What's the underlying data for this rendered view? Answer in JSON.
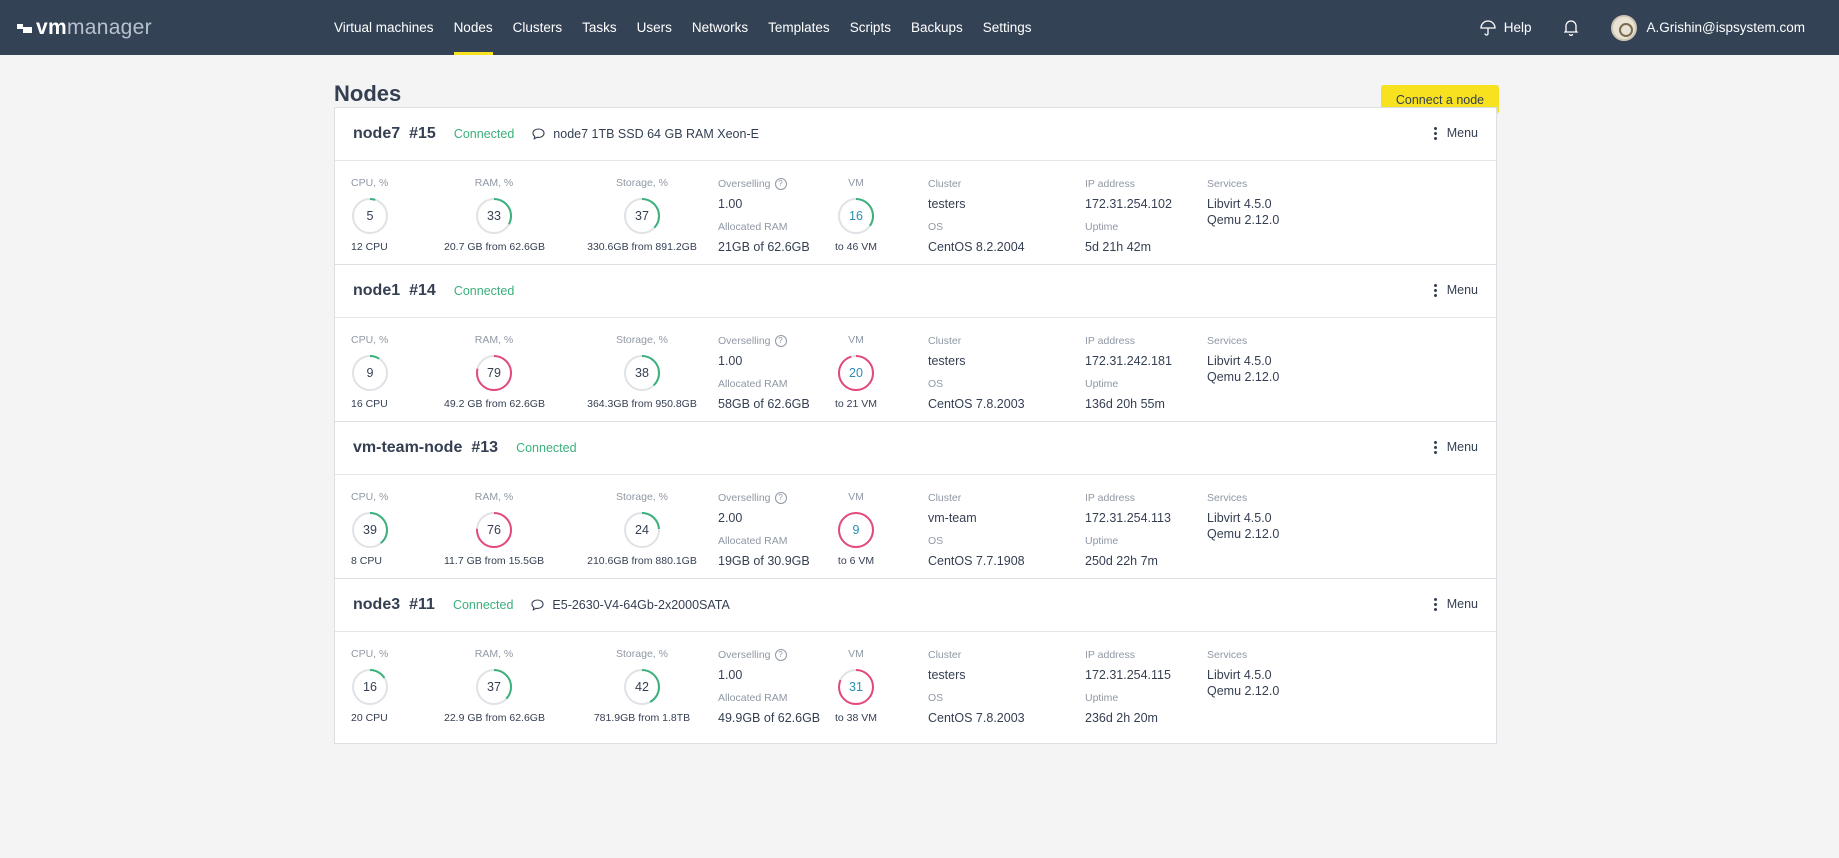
{
  "app": {
    "logo_vm": "vm",
    "logo_manager": "manager",
    "nav": [
      "Virtual machines",
      "Nodes",
      "Clusters",
      "Tasks",
      "Users",
      "Networks",
      "Templates",
      "Scripts",
      "Backups",
      "Settings"
    ],
    "active_nav": "Nodes",
    "help_label": "Help",
    "user_email": "A.Grishin@ispsystem.com"
  },
  "page": {
    "title": "Nodes",
    "connect_button": "Connect a node"
  },
  "labels": {
    "cpu": "CPU, %",
    "ram": "RAM, %",
    "storage": "Storage, %",
    "overselling": "Overselling",
    "allocated_ram": "Allocated RAM",
    "vm": "VM",
    "cluster": "Cluster",
    "os": "OS",
    "ip": "IP address",
    "uptime": "Uptime",
    "services": "Services",
    "menu": "Menu",
    "help_mark": "?"
  },
  "colors": {
    "ok": "#3bb07b",
    "warn": "#e34a7b",
    "accent": "#f8e21f"
  },
  "nodes": [
    {
      "name": "node7",
      "id": "#15",
      "status": "Connected",
      "comment": "node7 1TB SSD 64 GB RAM Xeon-E",
      "cpu": 5,
      "cpu_sub": "12 CPU",
      "ram": 33,
      "ram_sub": "20.7 GB from 62.6GB",
      "storage": 37,
      "storage_sub": "330.6GB from 891.2GB",
      "overselling": "1.00",
      "allocated_ram": "21GB of 62.6GB",
      "vm": 16,
      "vm_max": 46,
      "vm_sub": "to 46 VM",
      "cluster": "testers",
      "os": "CentOS 8.2.2004",
      "ip": "172.31.254.102",
      "uptime": "5d 21h 42m",
      "services": [
        "Libvirt 4.5.0",
        "Qemu 2.12.0"
      ]
    },
    {
      "name": "node1",
      "id": "#14",
      "status": "Connected",
      "comment": "",
      "cpu": 9,
      "cpu_sub": "16 CPU",
      "ram": 79,
      "ram_sub": "49.2 GB from 62.6GB",
      "storage": 38,
      "storage_sub": "364.3GB from 950.8GB",
      "overselling": "1.00",
      "allocated_ram": "58GB of 62.6GB",
      "vm": 20,
      "vm_max": 21,
      "vm_sub": "to 21 VM",
      "cluster": "testers",
      "os": "CentOS 7.8.2003",
      "ip": "172.31.242.181",
      "uptime": "136d 20h 55m",
      "services": [
        "Libvirt 4.5.0",
        "Qemu 2.12.0"
      ]
    },
    {
      "name": "vm-team-node",
      "id": "#13",
      "status": "Connected",
      "comment": "",
      "cpu": 39,
      "cpu_sub": "8 CPU",
      "ram": 76,
      "ram_sub": "11.7 GB from 15.5GB",
      "storage": 24,
      "storage_sub": "210.6GB from 880.1GB",
      "overselling": "2.00",
      "allocated_ram": "19GB of 30.9GB",
      "vm": 9,
      "vm_max": 6,
      "vm_sub": "to 6 VM",
      "cluster": "vm-team",
      "os": "CentOS 7.7.1908",
      "ip": "172.31.254.113",
      "uptime": "250d 22h 7m",
      "services": [
        "Libvirt 4.5.0",
        "Qemu 2.12.0"
      ]
    },
    {
      "name": "node3",
      "id": "#11",
      "status": "Connected",
      "comment": "E5-2630-V4-64Gb-2x2000SATA",
      "cpu": 16,
      "cpu_sub": "20 CPU",
      "ram": 37,
      "ram_sub": "22.9 GB from 62.6GB",
      "storage": 42,
      "storage_sub": "781.9GB from 1.8TB",
      "overselling": "1.00",
      "allocated_ram": "49.9GB of 62.6GB",
      "vm": 31,
      "vm_max": 38,
      "vm_sub": "to 38 VM",
      "cluster": "testers",
      "os": "CentOS 7.8.2003",
      "ip": "172.31.254.115",
      "uptime": "236d 2h 20m",
      "services": [
        "Libvirt 4.5.0",
        "Qemu 2.12.0"
      ]
    }
  ]
}
